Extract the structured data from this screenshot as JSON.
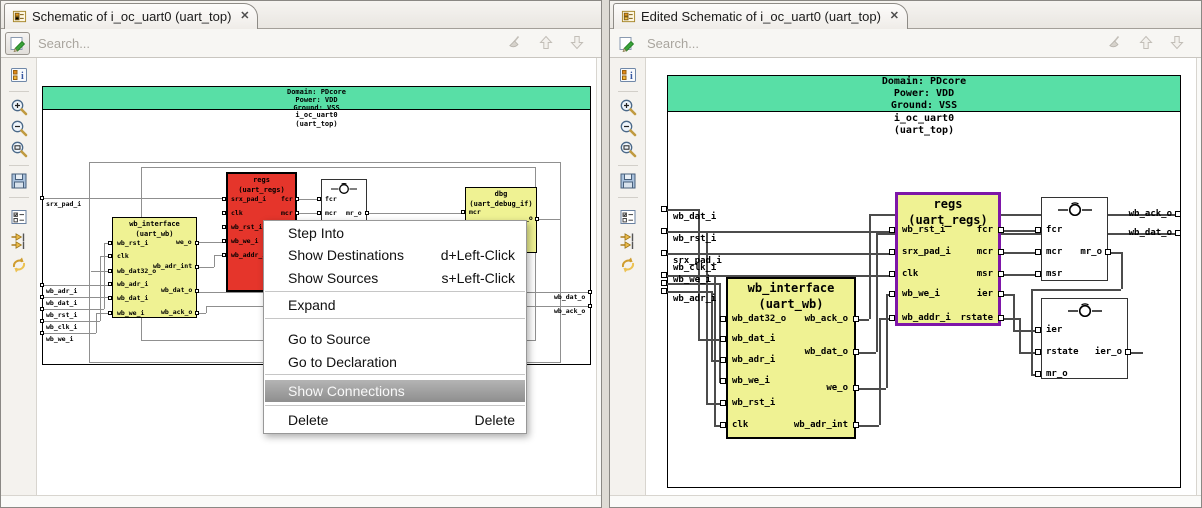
{
  "shared": {
    "search_placeholder": "Search...",
    "close_glyph": "✕",
    "sidebar_icons": [
      "properties",
      "zoom-in",
      "zoom-out",
      "zoom-fit",
      "save",
      "filter-options",
      "pin-connections",
      "refresh"
    ],
    "search_action_icons": [
      "clear-highlight-broom",
      "arrow-up",
      "arrow-down"
    ],
    "colors": {
      "header_green": "#58dfa6",
      "regs_red": "#e5352b",
      "block_yellow": "#eff293",
      "selection_purple": "#7e16a8",
      "menu_highlight": "#9a9a9a"
    }
  },
  "left": {
    "tab_title": "Schematic of i_oc_uart0 (uart_top)",
    "header": [
      "Domain: PDcore",
      "Power: VDD",
      "Ground: VSS"
    ],
    "instance": "i_oc_uart0",
    "module": "(uart_top)",
    "inputs": [
      "srx_pad_i",
      "wb_adr_i",
      "wb_dat_i",
      "wb_rst_i",
      "wb_clk_i",
      "wb_we_i"
    ],
    "outputs": [
      "wb_dat_o",
      "wb_ack_o"
    ],
    "regs": {
      "title": "regs",
      "subtitle": "(uart_regs)",
      "left_ports": [
        "srx_pad_i",
        "clk",
        "wb_rst_i",
        "wb_we_i",
        "wb_addr_i"
      ],
      "right_ports": [
        "fcr",
        "mcr"
      ]
    },
    "clkblock": {
      "left_ports": [
        "fcr",
        "mcr"
      ],
      "right_ports": [
        "mr_o"
      ]
    },
    "dbg": {
      "title": "dbg",
      "subtitle": "(uart_debug_if)",
      "left_ports": [
        "mcr"
      ],
      "right_ports": [
        "_o"
      ]
    },
    "wbif": {
      "title": "wb_interface",
      "subtitle": "(uart_wb)",
      "left_ports": [
        "wb_rst_i",
        "clk",
        "wb_dat32_o",
        "wb_adr_i",
        "wb_dat_i",
        "wb_we_i"
      ],
      "right_ports": [
        "we_o",
        "wb_adr_int",
        "wb_dat_o",
        "wb_ack_o"
      ]
    },
    "menu": [
      {
        "label": "Step Into",
        "shortcut": ""
      },
      {
        "label": "Show Destinations",
        "shortcut": "d+Left-Click"
      },
      {
        "label": "Show Sources",
        "shortcut": "s+Left-Click"
      },
      {
        "label": "Expand",
        "shortcut": ""
      },
      {
        "label": "Go to Source",
        "shortcut": ""
      },
      {
        "label": "Go to Declaration",
        "shortcut": ""
      },
      {
        "label": "Show Connections",
        "shortcut": ""
      },
      {
        "label": "Delete",
        "shortcut": "Delete"
      }
    ]
  },
  "right": {
    "tab_title": "Edited Schematic of i_oc_uart0 (uart_top)",
    "header": [
      "Domain: PDcore",
      "Power: VDD",
      "Ground: VSS"
    ],
    "instance": "i_oc_uart0",
    "module": "(uart_top)",
    "inputs": [
      "wb_dat_i",
      "wb_rst_i",
      "srx_pad_i",
      "wb_clk_i",
      "wb_we_i",
      "wb_adr_i"
    ],
    "outputs": [
      "wb_ack_o",
      "wb_dat_o"
    ],
    "regs": {
      "title": "regs",
      "subtitle": "(uart_regs)",
      "left_ports": [
        "wb_rst_i",
        "srx_pad_i",
        "clk",
        "wb_we_i",
        "wb_addr_i"
      ],
      "right_ports": [
        "fcr",
        "mcr",
        "msr",
        "ier",
        "rstate"
      ]
    },
    "block1": {
      "left_ports": [
        "fcr",
        "mcr",
        "msr"
      ],
      "right_ports": [
        "mr_o"
      ]
    },
    "block2": {
      "left_ports": [
        "ier",
        "rstate",
        "mr_o"
      ],
      "right_ports": [
        "ier_o"
      ]
    },
    "wbif": {
      "title": "wb_interface",
      "subtitle": "(uart_wb)",
      "left_ports": [
        "wb_dat32_o",
        "wb_dat_i",
        "wb_adr_i",
        "wb_we_i",
        "wb_rst_i",
        "clk"
      ],
      "right_ports": [
        "wb_ack_o",
        "wb_dat_o",
        "we_o",
        "wb_adr_int"
      ]
    }
  }
}
